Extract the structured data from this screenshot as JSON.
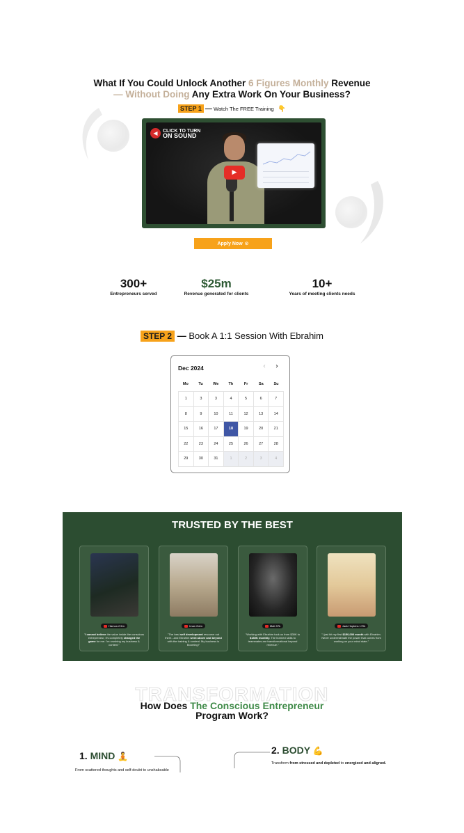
{
  "hero": {
    "headline_part1": "What If You Could Unlock Another ",
    "headline_accent1": "6 Figures Monthly",
    "headline_part2": " Revenue",
    "headline_accent2": "— Without Doing",
    "headline_part3": " Any Extra Work On Your Business?",
    "step1_badge": "STEP 1",
    "step1_dash": "—",
    "step1_text": "Watch The FREE Training",
    "step1_hand": "👇",
    "video": {
      "sound_line1": "CLICK TO TURN",
      "sound_line2": "ON SOUND"
    },
    "apply_label": "Apply Now",
    "apply_arrow": "⊙"
  },
  "stats": [
    {
      "value": "300+",
      "label": "Entrepreneurs served"
    },
    {
      "value": "$25m",
      "label": "Revenue generated for clients"
    },
    {
      "value": "10+",
      "label": "Years of meeting clients needs"
    }
  ],
  "step2": {
    "badge": "STEP 2",
    "dash": "—",
    "text": " Book A 1:1 Session With Ebrahim"
  },
  "calendar": {
    "month": "Dec 2024",
    "prev_icon": "‹",
    "next_icon": "›",
    "weekdays": [
      "Mo",
      "Tu",
      "We",
      "Th",
      "Fr",
      "Sa",
      "Su"
    ],
    "days": [
      "1",
      "3",
      "3",
      "4",
      "5",
      "6",
      "7",
      "8",
      "9",
      "10",
      "11",
      "12",
      "13",
      "14",
      "15",
      "16",
      "17",
      "18",
      "19",
      "20",
      "21",
      "22",
      "23",
      "24",
      "25",
      "26",
      "27",
      "28",
      "29",
      "30",
      "31",
      "1",
      "2",
      "3",
      "4"
    ],
    "selected_day": "18"
  },
  "trusted": {
    "title": "TRUSTED BY THE BEST",
    "cards": [
      {
        "channel": "Hamza 2.5m",
        "quote_pre": "\"",
        "quote_bold1": "I cannot believe",
        "quote_mid": " the value inside the conscious entrepreneur, it's completely ",
        "quote_bold2": "changed the game",
        "quote_post": " for me. I'm crushing my business & content.\""
      },
      {
        "channel": "Iman Gdm",
        "quote_pre": "\"The best ",
        "quote_bold1": "self development",
        "quote_mid": " resource out there...and Ebrahim ",
        "quote_bold2": "went above and beyond",
        "quote_post": " with the training & content. My business is Booming!\""
      },
      {
        "channel": "Matt 97k",
        "quote_pre": "\"Working with Ebrahim took us from $30K to ",
        "quote_bold1": "$180K monthly.",
        "quote_mid": " The learned skills to teammates are transformational beyond revenue.\"",
        "quote_bold2": "",
        "quote_post": ""
      },
      {
        "channel": "Jack Hopkins 170k",
        "quote_pre": "\"I just hit my first ",
        "quote_bold1": "$150,000 month",
        "quote_mid": " with Ebrahim. Never underestimate the power that comes from working on your mind state.\"",
        "quote_bold2": "",
        "quote_post": ""
      }
    ]
  },
  "program": {
    "watermark": "TRANSFORMATION",
    "title_part1": "How Does ",
    "title_accent": "The Conscious Entrepreneur",
    "title_part2": "Program Work?",
    "steps": [
      {
        "num": "1.",
        "name": "MIND",
        "emoji": "🧘",
        "text": "From scattered thoughts and self-doubt to unshakeable"
      },
      {
        "num": "2.",
        "name": "BODY",
        "emoji": "💪",
        "text_pre": "Transform ",
        "text_bold1": "from stressed and depleted",
        "text_mid": " to ",
        "text_bold2": "energized and aligned."
      }
    ]
  },
  "colors": {
    "accent_gold": "#c4b09a",
    "step_orange": "#f7a21a",
    "brand_green": "#2c4d31",
    "calendar_selected": "#3f56a5"
  }
}
